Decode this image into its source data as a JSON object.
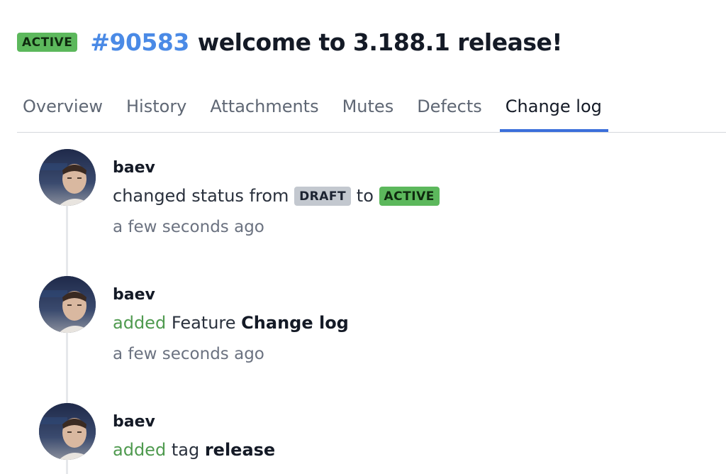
{
  "header": {
    "status": "ACTIVE",
    "id": "#90583",
    "title": "welcome to 3.188.1 release!"
  },
  "tabs": [
    {
      "label": "Overview"
    },
    {
      "label": "History"
    },
    {
      "label": "Attachments"
    },
    {
      "label": "Mutes"
    },
    {
      "label": "Defects"
    },
    {
      "label": "Change log",
      "active": true
    }
  ],
  "changelog": [
    {
      "author": "baev",
      "text": "changed status from",
      "from_status": "DRAFT",
      "to_word": "to",
      "to_status": "ACTIVE",
      "time": "a few seconds ago"
    },
    {
      "author": "baev",
      "verb": "added",
      "object_type": "Feature",
      "object_name": "Change log",
      "time": "a few seconds ago"
    },
    {
      "author": "baev",
      "verb": "added",
      "object_type": "tag",
      "object_name": "release"
    }
  ],
  "colors": {
    "active_badge": "#5cb85c",
    "draft_badge": "#c3c8cf",
    "id_link": "#4a8ae6",
    "tab_indicator": "#3b6fdb",
    "added_verb": "#4f9a4f"
  }
}
